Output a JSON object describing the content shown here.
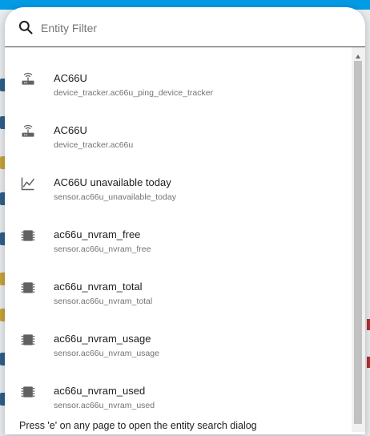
{
  "dialog": {
    "search": {
      "placeholder": "Entity Filter",
      "value": ""
    },
    "items": [
      {
        "title": "AC66U",
        "subtitle": "device_tracker.ac66u_ping_device_tracker",
        "icon": "router-icon"
      },
      {
        "title": "AC66U",
        "subtitle": "device_tracker.ac66u",
        "icon": "router-icon"
      },
      {
        "title": "AC66U unavailable today",
        "subtitle": "sensor.ac66u_unavailable_today",
        "icon": "chart-line-icon"
      },
      {
        "title": "ac66u_nvram_free",
        "subtitle": "sensor.ac66u_nvram_free",
        "icon": "memory-chip-icon"
      },
      {
        "title": "ac66u_nvram_total",
        "subtitle": "sensor.ac66u_nvram_total",
        "icon": "memory-chip-icon"
      },
      {
        "title": "ac66u_nvram_usage",
        "subtitle": "sensor.ac66u_nvram_usage",
        "icon": "memory-chip-icon"
      },
      {
        "title": "ac66u_nvram_used",
        "subtitle": "sensor.ac66u_nvram_used",
        "icon": "memory-chip-icon"
      }
    ],
    "footer_hint": "Press 'e' on any page to open the entity search dialog"
  },
  "colors": {
    "header_blue": "#039be5",
    "icon_gray": "#616161",
    "text_primary": "#212121",
    "text_secondary": "#727272"
  }
}
